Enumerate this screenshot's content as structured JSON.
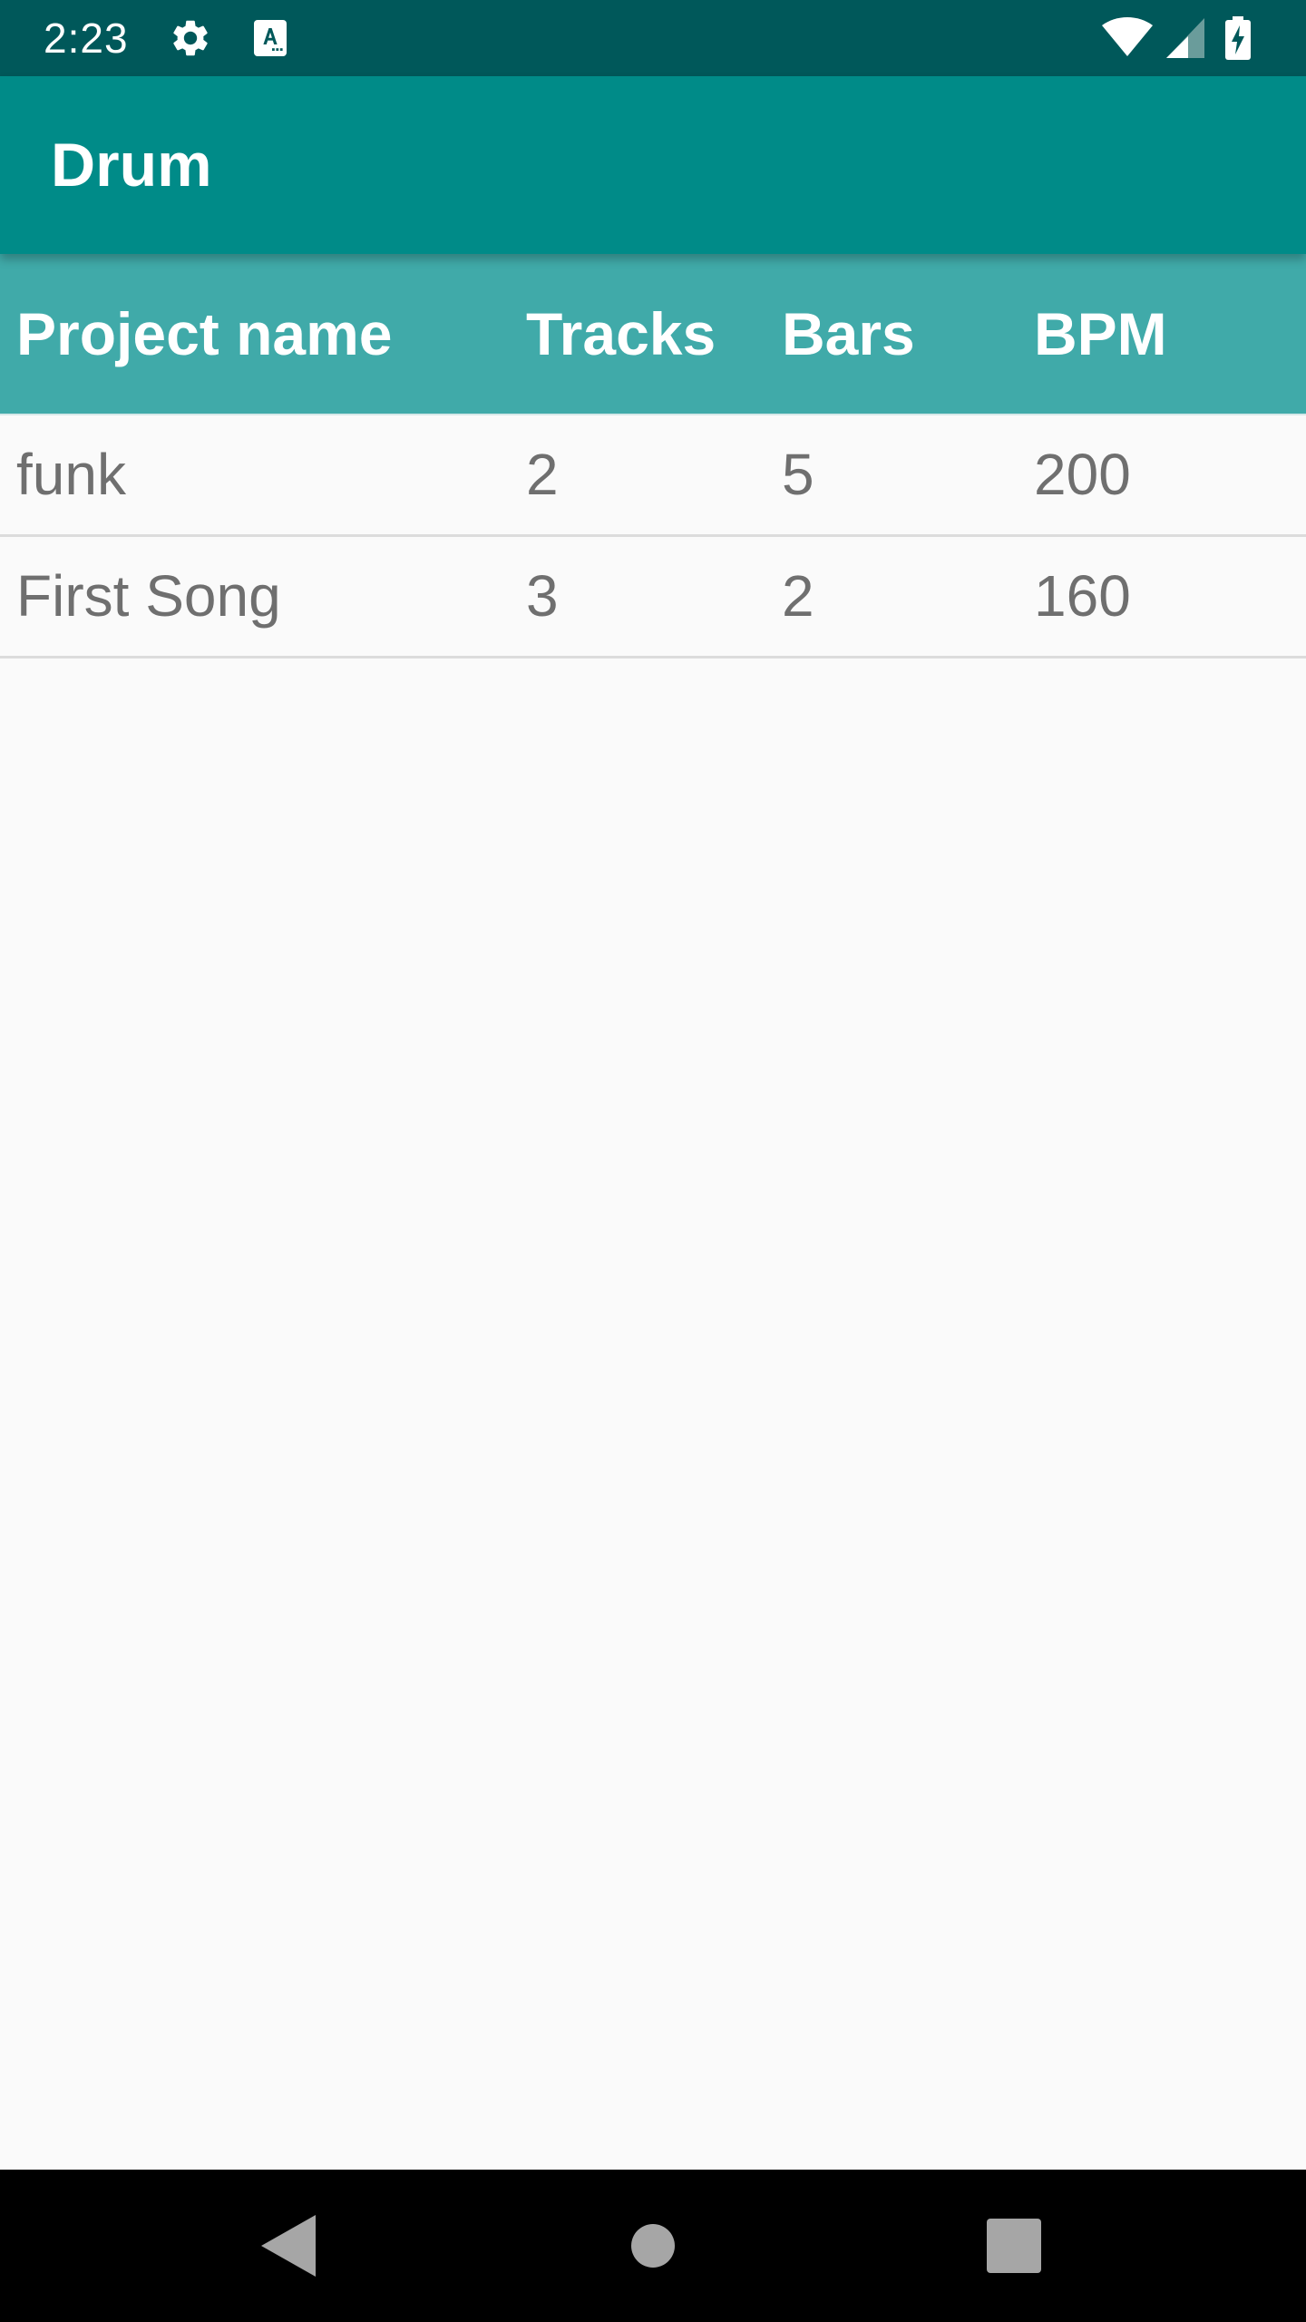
{
  "status_bar": {
    "time": "2:23",
    "icons": [
      "gear-icon",
      "font-a-icon",
      "wifi-icon",
      "cell-signal-icon",
      "battery-charging-icon"
    ]
  },
  "app_bar": {
    "title": "Drum"
  },
  "table": {
    "columns": [
      "Project name",
      "Tracks",
      "Bars",
      "BPM"
    ],
    "rows": [
      [
        "funk",
        "2",
        "5",
        "200"
      ],
      [
        "First Song",
        "3",
        "2",
        "160"
      ]
    ]
  },
  "nav_bar": {
    "icons": [
      "back-icon",
      "home-icon",
      "recents-icon"
    ]
  },
  "colors": {
    "status_bar": "#00585a",
    "app_bar": "#008b88",
    "table_header": "#40aaa9",
    "background": "#fafafa",
    "row_text": "#6f6f6f"
  }
}
